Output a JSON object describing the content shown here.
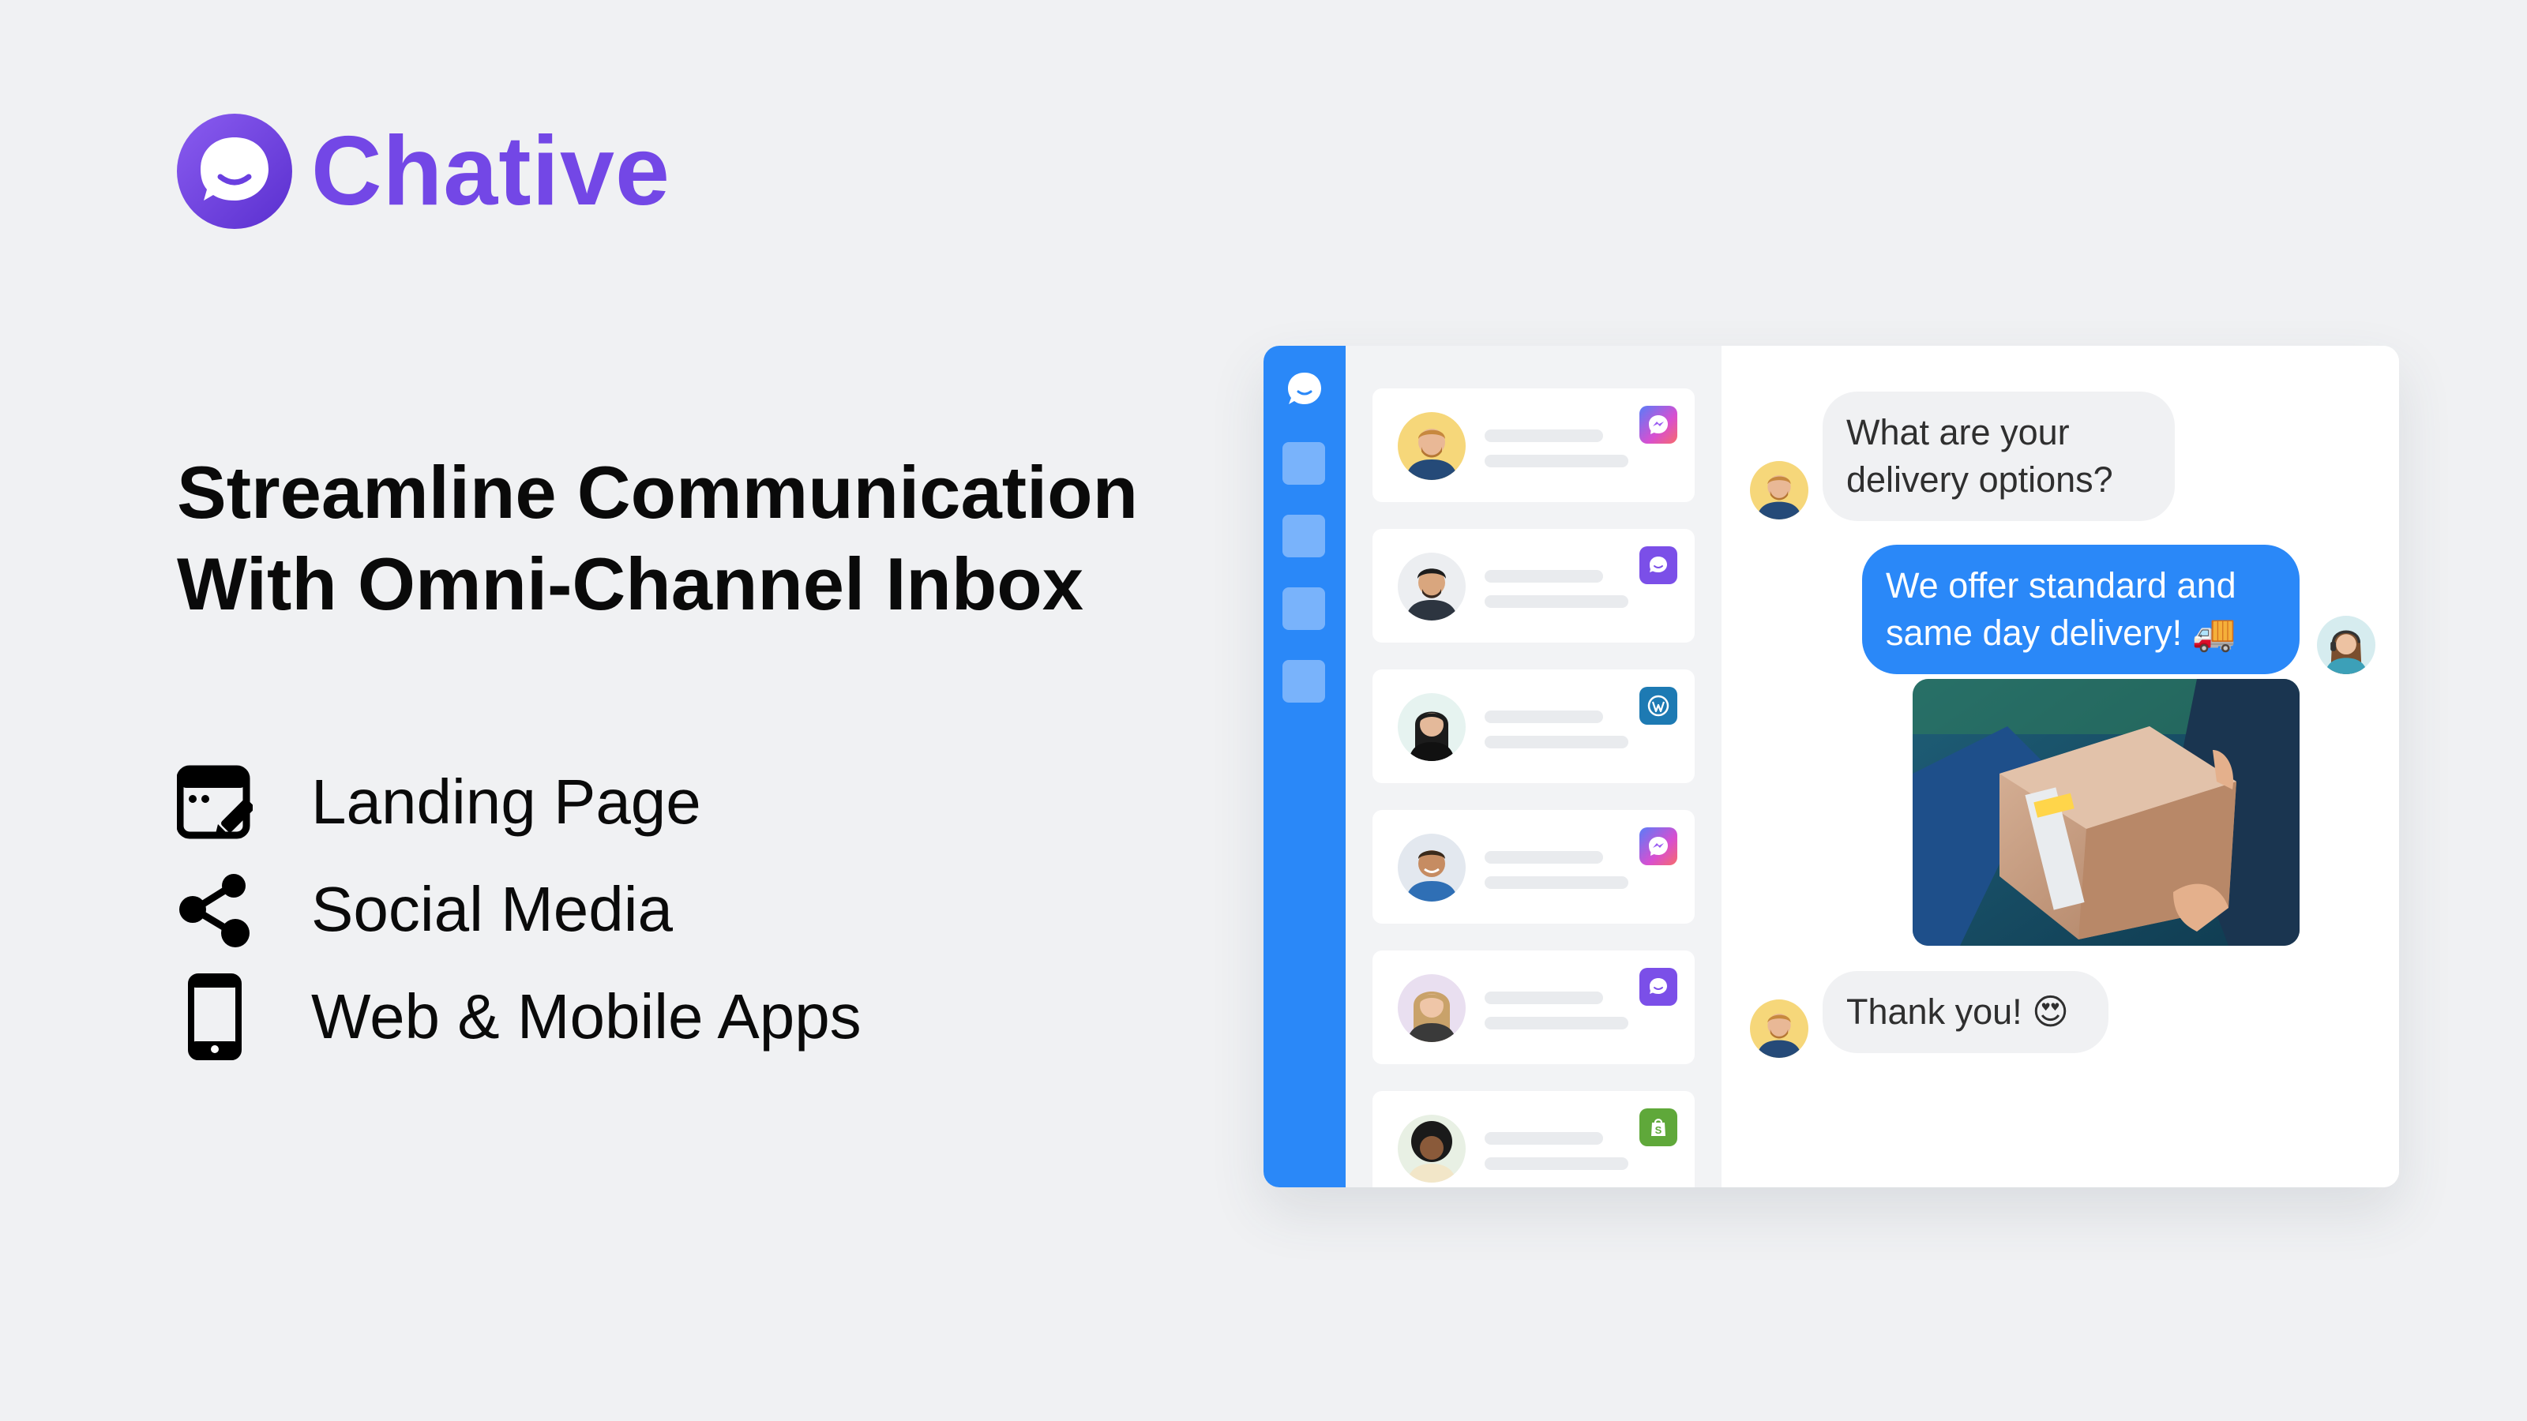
{
  "brand": {
    "name": "Chative",
    "logo_icon": "chat-bubble-smile-icon",
    "color": "#7347e6"
  },
  "headline": {
    "line1": "Streamline Communication",
    "line2": "With Omni-Channel Inbox"
  },
  "features": [
    {
      "label": "Landing Page",
      "icon": "landing-page-edit-icon"
    },
    {
      "label": "Social Media",
      "icon": "share-icon"
    },
    {
      "label": "Web & Mobile Apps",
      "icon": "smartphone-icon"
    }
  ],
  "app": {
    "accent_color": "#2a88f8",
    "rail": {
      "logo_icon": "chat-bubble-icon",
      "nav_buttons": 4
    },
    "conversations": [
      {
        "avatar": "man-blond-beard-avatar",
        "channel": "messenger"
      },
      {
        "avatar": "man-dark-hair-avatar",
        "channel": "live-chat"
      },
      {
        "avatar": "woman-dark-hair-avatar",
        "channel": "wordpress"
      },
      {
        "avatar": "man-smiling-avatar",
        "channel": "messenger"
      },
      {
        "avatar": "woman-blonde-avatar",
        "channel": "live-chat"
      },
      {
        "avatar": "woman-curly-hair-avatar",
        "channel": "shopify"
      }
    ],
    "chat": {
      "messages": [
        {
          "direction": "in",
          "line1": "What are your",
          "line2": "delivery options?"
        },
        {
          "direction": "out",
          "line1": "We offer standard and",
          "line2": "same day delivery! 🚚"
        },
        {
          "direction": "out",
          "attachment": "delivery-package-photo"
        },
        {
          "direction": "in",
          "line1": "Thank you! 😍"
        }
      ]
    }
  }
}
